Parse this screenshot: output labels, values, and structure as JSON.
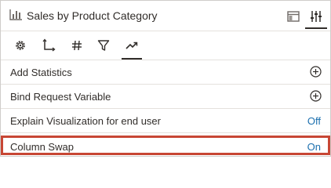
{
  "header": {
    "title": "Sales by Product Category",
    "title_icon": "bar-chart-icon",
    "buttons": [
      {
        "name": "layout-panel-icon"
      },
      {
        "name": "properties-sliders-icon",
        "active": true
      }
    ]
  },
  "tabs": [
    {
      "name": "general-settings-icon"
    },
    {
      "name": "axis-icon"
    },
    {
      "name": "number-format-icon"
    },
    {
      "name": "filter-icon"
    },
    {
      "name": "analytics-trend-icon",
      "active": true
    }
  ],
  "rows": [
    {
      "label": "Add Statistics",
      "action": "add-icon"
    },
    {
      "label": "Bind Request Variable",
      "action": "add-icon"
    },
    {
      "label": "Explain Visualization for end user",
      "value": "Off"
    },
    {
      "label": "Column Swap",
      "value": "On",
      "highlighted": true
    }
  ],
  "colors": {
    "accent_link": "#1b6fae",
    "highlight_border": "#c74634",
    "text": "#312d2a"
  }
}
